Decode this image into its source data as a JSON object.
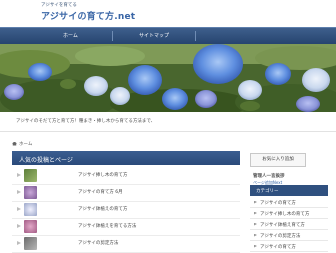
{
  "header": {
    "tagline": "アジサイを育てる",
    "site_title": "アジサイの育て方.net"
  },
  "nav": [
    {
      "label": "ホーム"
    },
    {
      "label": "サイトマップ"
    }
  ],
  "hero": {
    "caption": "アジサイのそだて方と育て方！種まき・挿し木から育てる方法まで、"
  },
  "breadcrumb": {
    "home": "ホーム"
  },
  "popular": {
    "title": "人気の投稿とページ",
    "items": [
      {
        "label": "アジサイ挿し木の育て方"
      },
      {
        "label": "アジサイの育て方 6月"
      },
      {
        "label": "アジサイ鉢植えの育て方"
      },
      {
        "label": "アジサイ鉢植えを育てる方法"
      },
      {
        "label": "アジサイの剪定方法"
      }
    ]
  },
  "sidebar": {
    "button_label": "お気に入り追加",
    "heading": "管理人一言挨拶",
    "note": "ページ追加Next",
    "category_title": "カテゴリー",
    "categories": [
      {
        "label": "アジサイの育て方"
      },
      {
        "label": "アジサイ挿し木の育て方"
      },
      {
        "label": "アジサイ鉢植え育て方"
      },
      {
        "label": "アジサイの剪定方法"
      },
      {
        "label": "アジサイの育て方"
      }
    ]
  }
}
